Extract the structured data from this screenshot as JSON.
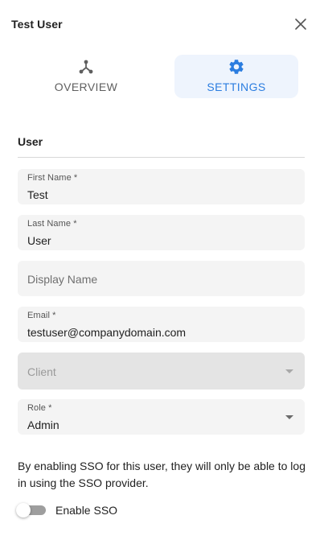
{
  "header": {
    "title": "Test User",
    "close_icon": "close-icon"
  },
  "tabs": [
    {
      "label": "OVERVIEW",
      "icon": "share-node-icon",
      "active": false
    },
    {
      "label": "SETTINGS",
      "icon": "gear-icon",
      "active": true
    }
  ],
  "section": {
    "title": "User"
  },
  "form": {
    "first_name": {
      "label": "First Name *",
      "value": "Test"
    },
    "last_name": {
      "label": "Last Name *",
      "value": "User"
    },
    "display_name": {
      "placeholder": "Display Name",
      "value": ""
    },
    "email": {
      "label": "Email *",
      "value": "testuser@companydomain.com"
    },
    "client": {
      "placeholder": "Client",
      "disabled": true
    },
    "role": {
      "label": "Role *",
      "value": "Admin"
    }
  },
  "sso": {
    "note": "By enabling SSO for this user, they will only be able to log in using the SSO provider.",
    "toggle_label": "Enable SSO",
    "enabled": false
  },
  "colors": {
    "accent": "#2b7de0",
    "active_tab_bg": "#eef4fd",
    "field_bg": "#f4f4f4",
    "disabled_field_bg": "#e4e4e4",
    "toggle_off": "#9e9e9e"
  }
}
